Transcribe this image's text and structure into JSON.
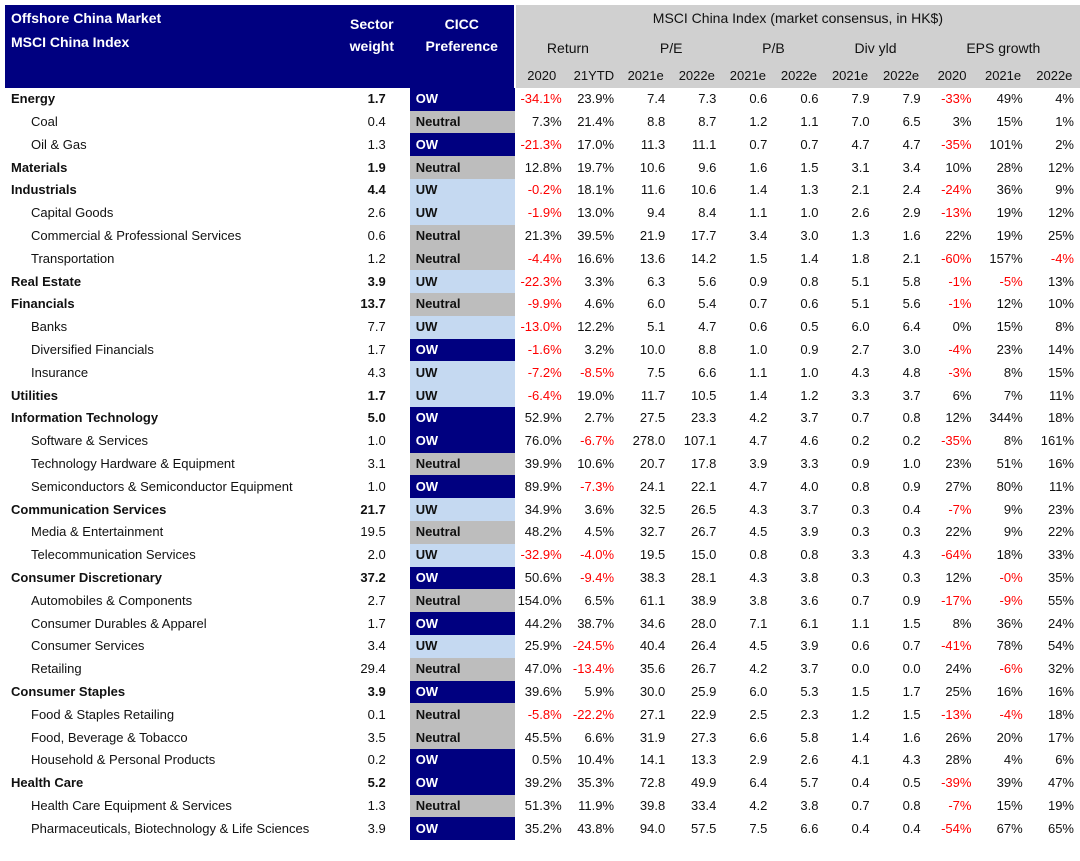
{
  "header": {
    "title1": "Offshore China Market",
    "title2": "MSCI China Index",
    "sector_weight": "Sector weight",
    "cicc_preference": "CICC Preference",
    "consensus": "MSCI China Index (market consensus, in HK$)",
    "groups": [
      "Return",
      "P/E",
      "P/B",
      "Div yld",
      "EPS growth"
    ],
    "subcols": [
      "2020",
      "21YTD",
      "2021e",
      "2022e",
      "2021e",
      "2022e",
      "2021e",
      "2022e",
      "2020",
      "2021e",
      "2022e"
    ]
  },
  "rows": [
    {
      "name": "Energy",
      "level": "sector",
      "weight": "1.7",
      "pref": "OW",
      "vals": [
        "-34.1%",
        "23.9%",
        "7.4",
        "7.3",
        "0.6",
        "0.6",
        "7.9",
        "7.9",
        "-33%",
        "49%",
        "4%"
      ]
    },
    {
      "name": "Coal",
      "level": "sub",
      "weight": "0.4",
      "pref": "Neutral",
      "vals": [
        "7.3%",
        "21.4%",
        "8.8",
        "8.7",
        "1.2",
        "1.1",
        "7.0",
        "6.5",
        "3%",
        "15%",
        "1%"
      ]
    },
    {
      "name": "Oil & Gas",
      "level": "sub",
      "weight": "1.3",
      "pref": "OW",
      "vals": [
        "-21.3%",
        "17.0%",
        "11.3",
        "11.1",
        "0.7",
        "0.7",
        "4.7",
        "4.7",
        "-35%",
        "101%",
        "2%"
      ]
    },
    {
      "name": "Materials",
      "level": "sector",
      "weight": "1.9",
      "pref": "Neutral",
      "vals": [
        "12.8%",
        "19.7%",
        "10.6",
        "9.6",
        "1.6",
        "1.5",
        "3.1",
        "3.4",
        "10%",
        "28%",
        "12%"
      ]
    },
    {
      "name": "Industrials",
      "level": "sector",
      "weight": "4.4",
      "pref": "UW",
      "vals": [
        "-0.2%",
        "18.1%",
        "11.6",
        "10.6",
        "1.4",
        "1.3",
        "2.1",
        "2.4",
        "-24%",
        "36%",
        "9%"
      ]
    },
    {
      "name": "Capital Goods",
      "level": "sub",
      "weight": "2.6",
      "pref": "UW",
      "vals": [
        "-1.9%",
        "13.0%",
        "9.4",
        "8.4",
        "1.1",
        "1.0",
        "2.6",
        "2.9",
        "-13%",
        "19%",
        "12%"
      ]
    },
    {
      "name": "Commercial & Professional Services",
      "level": "sub",
      "weight": "0.6",
      "pref": "Neutral",
      "vals": [
        "21.3%",
        "39.5%",
        "21.9",
        "17.7",
        "3.4",
        "3.0",
        "1.3",
        "1.6",
        "22%",
        "19%",
        "25%"
      ]
    },
    {
      "name": "Transportation",
      "level": "sub",
      "weight": "1.2",
      "pref": "Neutral",
      "vals": [
        "-4.4%",
        "16.6%",
        "13.6",
        "14.2",
        "1.5",
        "1.4",
        "1.8",
        "2.1",
        "-60%",
        "157%",
        "-4%"
      ]
    },
    {
      "name": "Real Estate",
      "level": "sector",
      "weight": "3.9",
      "pref": "UW",
      "vals": [
        "-22.3%",
        "3.3%",
        "6.3",
        "5.6",
        "0.9",
        "0.8",
        "5.1",
        "5.8",
        "-1%",
        "-5%",
        "13%"
      ]
    },
    {
      "name": "Financials",
      "level": "sector",
      "weight": "13.7",
      "pref": "Neutral",
      "vals": [
        "-9.9%",
        "4.6%",
        "6.0",
        "5.4",
        "0.7",
        "0.6",
        "5.1",
        "5.6",
        "-1%",
        "12%",
        "10%"
      ]
    },
    {
      "name": "Banks",
      "level": "sub",
      "weight": "7.7",
      "pref": "UW",
      "vals": [
        "-13.0%",
        "12.2%",
        "5.1",
        "4.7",
        "0.6",
        "0.5",
        "6.0",
        "6.4",
        "0%",
        "15%",
        "8%"
      ]
    },
    {
      "name": "Diversified Financials",
      "level": "sub",
      "weight": "1.7",
      "pref": "OW",
      "vals": [
        "-1.6%",
        "3.2%",
        "10.0",
        "8.8",
        "1.0",
        "0.9",
        "2.7",
        "3.0",
        "-4%",
        "23%",
        "14%"
      ]
    },
    {
      "name": "Insurance",
      "level": "sub",
      "weight": "4.3",
      "pref": "UW",
      "vals": [
        "-7.2%",
        "-8.5%",
        "7.5",
        "6.6",
        "1.1",
        "1.0",
        "4.3",
        "4.8",
        "-3%",
        "8%",
        "15%"
      ]
    },
    {
      "name": "Utilities",
      "level": "sector",
      "weight": "1.7",
      "pref": "UW",
      "vals": [
        "-6.4%",
        "19.0%",
        "11.7",
        "10.5",
        "1.4",
        "1.2",
        "3.3",
        "3.7",
        "6%",
        "7%",
        "11%"
      ]
    },
    {
      "name": "Information Technology",
      "level": "sector",
      "weight": "5.0",
      "pref": "OW",
      "vals": [
        "52.9%",
        "2.7%",
        "27.5",
        "23.3",
        "4.2",
        "3.7",
        "0.7",
        "0.8",
        "12%",
        "344%",
        "18%"
      ]
    },
    {
      "name": "Software & Services",
      "level": "sub",
      "weight": "1.0",
      "pref": "OW",
      "vals": [
        "76.0%",
        "-6.7%",
        "278.0",
        "107.1",
        "4.7",
        "4.6",
        "0.2",
        "0.2",
        "-35%",
        "8%",
        "161%"
      ]
    },
    {
      "name": "Technology Hardware & Equipment",
      "level": "sub",
      "weight": "3.1",
      "pref": "Neutral",
      "vals": [
        "39.9%",
        "10.6%",
        "20.7",
        "17.8",
        "3.9",
        "3.3",
        "0.9",
        "1.0",
        "23%",
        "51%",
        "16%"
      ]
    },
    {
      "name": "Semiconductors & Semiconductor Equipment",
      "level": "sub",
      "weight": "1.0",
      "pref": "OW",
      "vals": [
        "89.9%",
        "-7.3%",
        "24.1",
        "22.1",
        "4.7",
        "4.0",
        "0.8",
        "0.9",
        "27%",
        "80%",
        "11%"
      ]
    },
    {
      "name": "Communication Services",
      "level": "sector",
      "weight": "21.7",
      "pref": "UW",
      "vals": [
        "34.9%",
        "3.6%",
        "32.5",
        "26.5",
        "4.3",
        "3.7",
        "0.3",
        "0.4",
        "-7%",
        "9%",
        "23%"
      ]
    },
    {
      "name": "Media & Entertainment",
      "level": "sub",
      "weight": "19.5",
      "pref": "Neutral",
      "vals": [
        "48.2%",
        "4.5%",
        "32.7",
        "26.7",
        "4.5",
        "3.9",
        "0.3",
        "0.3",
        "22%",
        "9%",
        "22%"
      ]
    },
    {
      "name": "Telecommunication Services",
      "level": "sub",
      "weight": "2.0",
      "pref": "UW",
      "vals": [
        "-32.9%",
        "-4.0%",
        "19.5",
        "15.0",
        "0.8",
        "0.8",
        "3.3",
        "4.3",
        "-64%",
        "18%",
        "33%"
      ]
    },
    {
      "name": "Consumer Discretionary",
      "level": "sector",
      "weight": "37.2",
      "pref": "OW",
      "vals": [
        "50.6%",
        "-9.4%",
        "38.3",
        "28.1",
        "4.3",
        "3.8",
        "0.3",
        "0.3",
        "12%",
        "-0%",
        "35%"
      ]
    },
    {
      "name": "Automobiles & Components",
      "level": "sub",
      "weight": "2.7",
      "pref": "Neutral",
      "vals": [
        "154.0%",
        "6.5%",
        "61.1",
        "38.9",
        "3.8",
        "3.6",
        "0.7",
        "0.9",
        "-17%",
        "-9%",
        "55%"
      ]
    },
    {
      "name": "Consumer Durables & Apparel",
      "level": "sub",
      "weight": "1.7",
      "pref": "OW",
      "vals": [
        "44.2%",
        "38.7%",
        "34.6",
        "28.0",
        "7.1",
        "6.1",
        "1.1",
        "1.5",
        "8%",
        "36%",
        "24%"
      ]
    },
    {
      "name": "Consumer Services",
      "level": "sub",
      "weight": "3.4",
      "pref": "UW",
      "vals": [
        "25.9%",
        "-24.5%",
        "40.4",
        "26.4",
        "4.5",
        "3.9",
        "0.6",
        "0.7",
        "-41%",
        "78%",
        "54%"
      ]
    },
    {
      "name": "Retailing",
      "level": "sub",
      "weight": "29.4",
      "pref": "Neutral",
      "vals": [
        "47.0%",
        "-13.4%",
        "35.6",
        "26.7",
        "4.2",
        "3.7",
        "0.0",
        "0.0",
        "24%",
        "-6%",
        "32%"
      ]
    },
    {
      "name": "Consumer Staples",
      "level": "sector",
      "weight": "3.9",
      "pref": "OW",
      "vals": [
        "39.6%",
        "5.9%",
        "30.0",
        "25.9",
        "6.0",
        "5.3",
        "1.5",
        "1.7",
        "25%",
        "16%",
        "16%"
      ]
    },
    {
      "name": "Food & Staples Retailing",
      "level": "sub",
      "weight": "0.1",
      "pref": "Neutral",
      "vals": [
        "-5.8%",
        "-22.2%",
        "27.1",
        "22.9",
        "2.5",
        "2.3",
        "1.2",
        "1.5",
        "-13%",
        "-4%",
        "18%"
      ]
    },
    {
      "name": "Food, Beverage & Tobacco",
      "level": "sub",
      "weight": "3.5",
      "pref": "Neutral",
      "vals": [
        "45.5%",
        "6.6%",
        "31.9",
        "27.3",
        "6.6",
        "5.8",
        "1.4",
        "1.6",
        "26%",
        "20%",
        "17%"
      ]
    },
    {
      "name": "Household & Personal Products",
      "level": "sub",
      "weight": "0.2",
      "pref": "OW",
      "vals": [
        "0.5%",
        "10.4%",
        "14.1",
        "13.3",
        "2.9",
        "2.6",
        "4.1",
        "4.3",
        "28%",
        "4%",
        "6%"
      ]
    },
    {
      "name": "Health Care",
      "level": "sector",
      "weight": "5.2",
      "pref": "OW",
      "vals": [
        "39.2%",
        "35.3%",
        "72.8",
        "49.9",
        "6.4",
        "5.7",
        "0.4",
        "0.5",
        "-39%",
        "39%",
        "47%"
      ]
    },
    {
      "name": "Health Care Equipment & Services",
      "level": "sub",
      "weight": "1.3",
      "pref": "Neutral",
      "vals": [
        "51.3%",
        "11.9%",
        "39.8",
        "33.4",
        "4.2",
        "3.8",
        "0.7",
        "0.8",
        "-7%",
        "15%",
        "19%"
      ]
    },
    {
      "name": "Pharmaceuticals, Biotechnology & Life Sciences",
      "level": "sub",
      "weight": "3.9",
      "pref": "OW",
      "vals": [
        "35.2%",
        "43.8%",
        "94.0",
        "57.5",
        "7.5",
        "6.6",
        "0.4",
        "0.4",
        "-54%",
        "67%",
        "65%"
      ]
    }
  ],
  "colors": {
    "ow": "#000080",
    "uw": "#c5d9f1",
    "neutral": "#bdbdbd",
    "header_gray": "#d0d0d0",
    "negative": "#ff0000"
  }
}
